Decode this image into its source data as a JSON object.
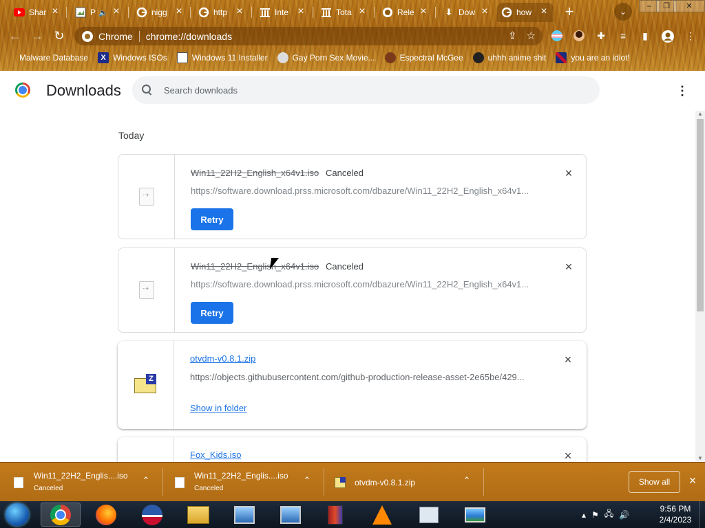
{
  "tabs": [
    {
      "title": "Shar",
      "icon": "youtube-icon",
      "color": "#ff0000"
    },
    {
      "title": "P",
      "icon": "picture-icon",
      "color": "#ffffff"
    },
    {
      "title": "nigg",
      "icon": "google-icon",
      "color": "#ffffff"
    },
    {
      "title": "http",
      "icon": "google-icon",
      "color": "#ffffff"
    },
    {
      "title": "Inte",
      "icon": "archive-icon",
      "color": "#ffffff"
    },
    {
      "title": "Tota",
      "icon": "archive-icon",
      "color": "#ffffff"
    },
    {
      "title": "Rele",
      "icon": "github-icon",
      "color": "#ffffff"
    },
    {
      "title": "Dow",
      "icon": "download-icon",
      "color": "#ffffff"
    },
    {
      "title": "how",
      "icon": "google-icon",
      "color": "#ffffff"
    }
  ],
  "omnibox": {
    "site": "Chrome",
    "url": "chrome://downloads"
  },
  "bookmarks": [
    {
      "label": "Malware Database",
      "icon": "folder-icon"
    },
    {
      "label": "Windows ISOs",
      "icon": "x-logo-icon"
    },
    {
      "label": "Windows 11 Installer",
      "icon": "picture-icon"
    },
    {
      "label": "Gay Porn Sex Movie...",
      "icon": "bookmark-site-icon"
    },
    {
      "label": "Espectral McGee",
      "icon": "bookmark-site-icon"
    },
    {
      "label": "uhhh anime shit",
      "icon": "bookmark-site-icon"
    },
    {
      "label": "you are an idiot!",
      "icon": "uk-flag-icon"
    }
  ],
  "page": {
    "title": "Downloads",
    "search_placeholder": "Search downloads",
    "section_date": "Today"
  },
  "downloads": [
    {
      "filename": "Win11_22H2_English_x64v1.iso",
      "status": "Canceled",
      "url": "https://software.download.prss.microsoft.com/dbazure/Win11_22H2_English_x64v1...",
      "action": "Retry"
    },
    {
      "filename": "Win11_22H2_English_x64v1.iso",
      "status": "Canceled",
      "url": "https://software.download.prss.microsoft.com/dbazure/Win11_22H2_English_x64v1...",
      "action": "Retry"
    },
    {
      "filename": "otvdm-v0.8.1.zip",
      "status": "",
      "url": "https://objects.githubusercontent.com/github-production-release-asset-2e65be/429...",
      "action": "Show in folder"
    },
    {
      "filename": "Fox_Kids.iso",
      "status": "",
      "url": "",
      "action": ""
    }
  ],
  "shelf": {
    "items": [
      {
        "name": "Win11_22H2_Englis....iso",
        "status": "Canceled"
      },
      {
        "name": "Win11_22H2_Englis....iso",
        "status": "Canceled"
      },
      {
        "name": "otvdm-v0.8.1.zip",
        "status": ""
      }
    ],
    "show_all_label": "Show all"
  },
  "taskbar": {
    "apps": [
      "chrome-icon",
      "firefox-icon",
      "obama-icon",
      "file-explorer-icon",
      "network-computer-icon",
      "network-computer-icon",
      "winrar-icon",
      "vlc-icon",
      "task-manager-icon",
      "photo-viewer-icon"
    ],
    "time": "9:56 PM",
    "date": "2/4/2023"
  },
  "colors": {
    "accent": "#1a73e8",
    "theme_wood": "#b06c14"
  }
}
